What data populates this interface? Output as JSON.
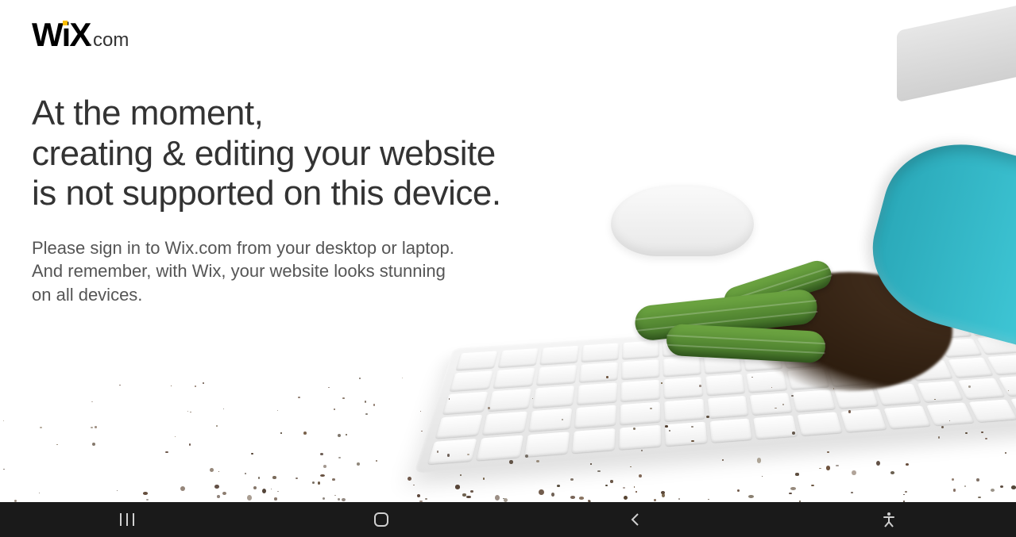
{
  "logo": {
    "brand": "WiX",
    "suffix": ".com"
  },
  "heading": {
    "line1": "At the moment,",
    "line2": "creating & editing your website",
    "line3": "is not supported on this device."
  },
  "subtext": {
    "line1": "Please sign in to Wix.com from your desktop or laptop.",
    "line2": "And remember, with Wix, your website looks stunning",
    "line3": "on all devices."
  },
  "nav": {
    "recents": "recents",
    "home": "home",
    "back": "back",
    "accessibility": "accessibility"
  }
}
